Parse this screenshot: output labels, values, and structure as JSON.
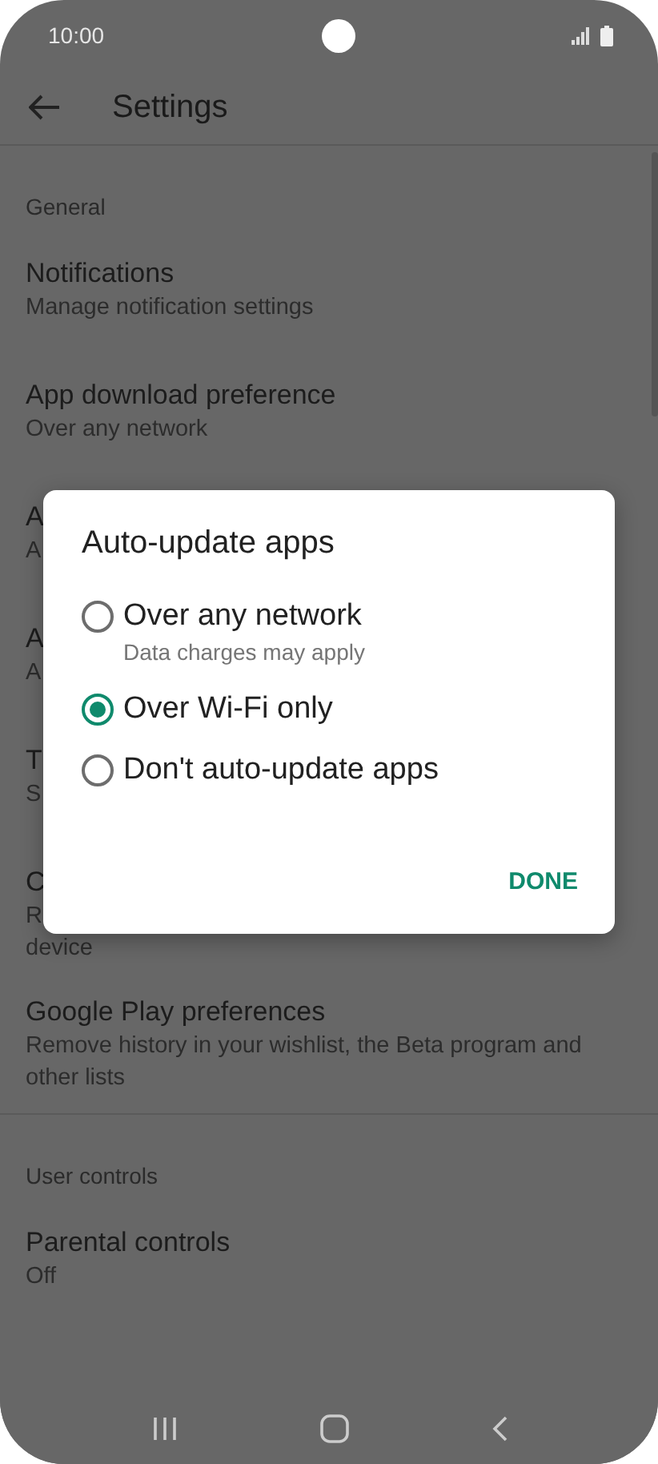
{
  "status_bar": {
    "time": "10:00"
  },
  "toolbar": {
    "title": "Settings"
  },
  "sections": [
    {
      "header": "General",
      "items": [
        {
          "title": "Notifications",
          "subtitle_lines": [
            "Manage notification settings"
          ]
        },
        {
          "title": "App download preference",
          "subtitle_lines": [
            "Over any network"
          ]
        },
        {
          "title": "A",
          "subtitle_lines": [
            "A"
          ]
        },
        {
          "title": "A",
          "subtitle_lines": [
            "A"
          ]
        },
        {
          "title": "T",
          "subtitle_lines": [
            "S"
          ]
        },
        {
          "title": "C",
          "subtitle_lines": [
            "R",
            "device"
          ]
        },
        {
          "title": "Google Play preferences",
          "subtitle_lines": [
            "Remove history in your wishlist, the Beta program and",
            "other lists"
          ]
        }
      ]
    },
    {
      "header": "User controls",
      "items": [
        {
          "title": "Parental controls",
          "subtitle_lines": [
            "Off"
          ]
        }
      ]
    }
  ],
  "dialog": {
    "title": "Auto-update apps",
    "options": [
      {
        "label": "Over any network",
        "description": "Data charges may apply",
        "selected": false
      },
      {
        "label": "Over Wi-Fi only",
        "selected": true
      },
      {
        "label": "Don't auto-update apps",
        "selected": false
      }
    ],
    "button": "DONE"
  }
}
